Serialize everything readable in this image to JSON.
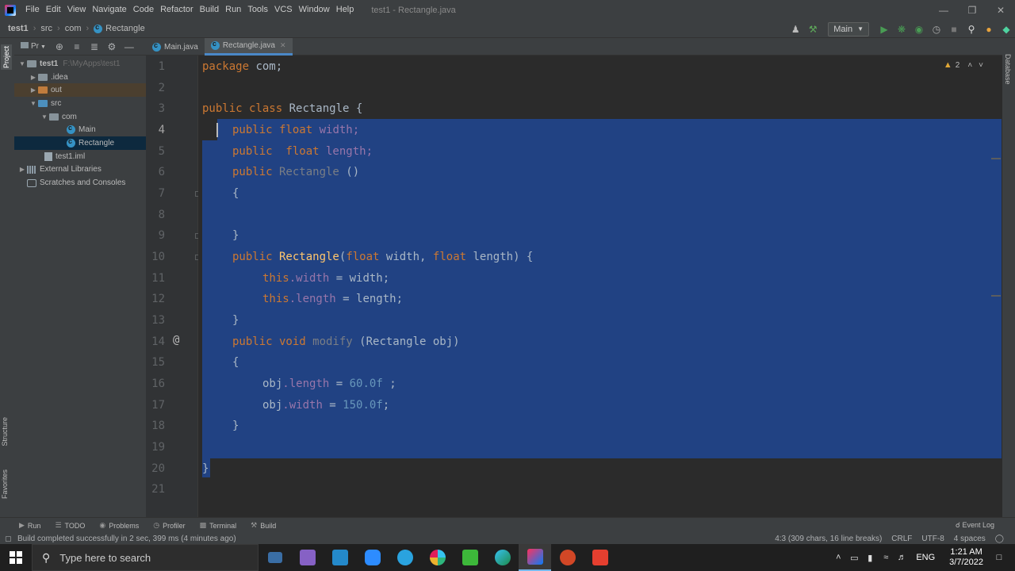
{
  "window": {
    "title": "test1 - Rectangle.java",
    "menu": [
      "File",
      "Edit",
      "View",
      "Navigate",
      "Code",
      "Refactor",
      "Build",
      "Run",
      "Tools",
      "VCS",
      "Window",
      "Help"
    ]
  },
  "breadcrumb": [
    "test1",
    "src",
    "com",
    "Rectangle"
  ],
  "run_config": "Main",
  "left_strip": {
    "project": "Project",
    "structure": "Structure",
    "favorites": "Favorites"
  },
  "right_strip": {
    "database": "Database"
  },
  "project": {
    "header": "Pr",
    "tree": [
      {
        "label": "test1",
        "path": "F:\\MyApps\\test1",
        "type": "module"
      },
      {
        "label": ".idea",
        "type": "folder"
      },
      {
        "label": "out",
        "type": "folder-orange"
      },
      {
        "label": "src",
        "type": "folder-blue"
      },
      {
        "label": "com",
        "type": "package"
      },
      {
        "label": "Main",
        "type": "class"
      },
      {
        "label": "Rectangle",
        "type": "class",
        "selected": true
      },
      {
        "label": "test1.iml",
        "type": "file"
      },
      {
        "label": "External Libraries",
        "type": "library"
      },
      {
        "label": "Scratches and Consoles",
        "type": "scratch"
      }
    ]
  },
  "tabs": [
    {
      "label": "Main.java",
      "active": false
    },
    {
      "label": "Rectangle.java",
      "active": true
    }
  ],
  "editor": {
    "warnings": "2",
    "line_numbers": [
      "1",
      "2",
      "3",
      "4",
      "5",
      "6",
      "7",
      "8",
      "9",
      "10",
      "11",
      "12",
      "13",
      "14",
      "15",
      "16",
      "17",
      "18",
      "19",
      "20",
      "21"
    ],
    "current_line": "4",
    "gutter_mark": "@",
    "code": {
      "l1_kw": "package",
      "l1_rest": " com;",
      "l3_kw": "public class",
      "l3_rest": " Rectangle {",
      "l4_kw": "public float",
      "l4_fld": " width;",
      "l5_kw": "public  float",
      "l5_fld": " length;",
      "l6_kw": "public",
      "l6_dim": " Rectangle",
      "l6_rest": " ()",
      "l7": "{",
      "l9": "}",
      "l10_kw": "public",
      "l10_fn": " Rectangle",
      "l10_a": "(",
      "l10_kw2": "float",
      "l10_b": " width, ",
      "l10_kw3": "float",
      "l10_c": " length) {",
      "l11_kw": "this",
      "l11_fld": ".width",
      "l11_rest": " = width;",
      "l12_kw": "this",
      "l12_fld": ".length",
      "l12_rest": " = length;",
      "l13": "}",
      "l14_kw": "public void",
      "l14_dim": " modify",
      "l14_rest": " (Rectangle obj)",
      "l15": "{",
      "l16_a": "obj",
      "l16_fld": ".length",
      "l16_b": " = ",
      "l16_num": "60.0f",
      "l16_c": " ;",
      "l17_a": "obj",
      "l17_fld": ".width",
      "l17_b": " = ",
      "l17_num": "150.0f",
      "l17_c": ";",
      "l18": "}",
      "l20": "}"
    }
  },
  "bottom_tools": [
    "Run",
    "TODO",
    "Problems",
    "Profiler",
    "Terminal",
    "Build"
  ],
  "event_log": "Event Log",
  "status": {
    "message": "Build completed successfully in 2 sec, 399 ms (4 minutes ago)",
    "position": "4:3 (309 chars, 16 line breaks)",
    "line_sep": "CRLF",
    "encoding": "UTF-8",
    "indent": "4 spaces"
  },
  "taskbar": {
    "search_placeholder": "Type here to search",
    "lang": "ENG",
    "time": "1:21 AM",
    "date": "3/7/2022"
  },
  "colors": {
    "selection": "#214283",
    "keyword": "#cc7832",
    "field": "#9876aa",
    "method": "#ffc66d",
    "number": "#6897bb"
  }
}
